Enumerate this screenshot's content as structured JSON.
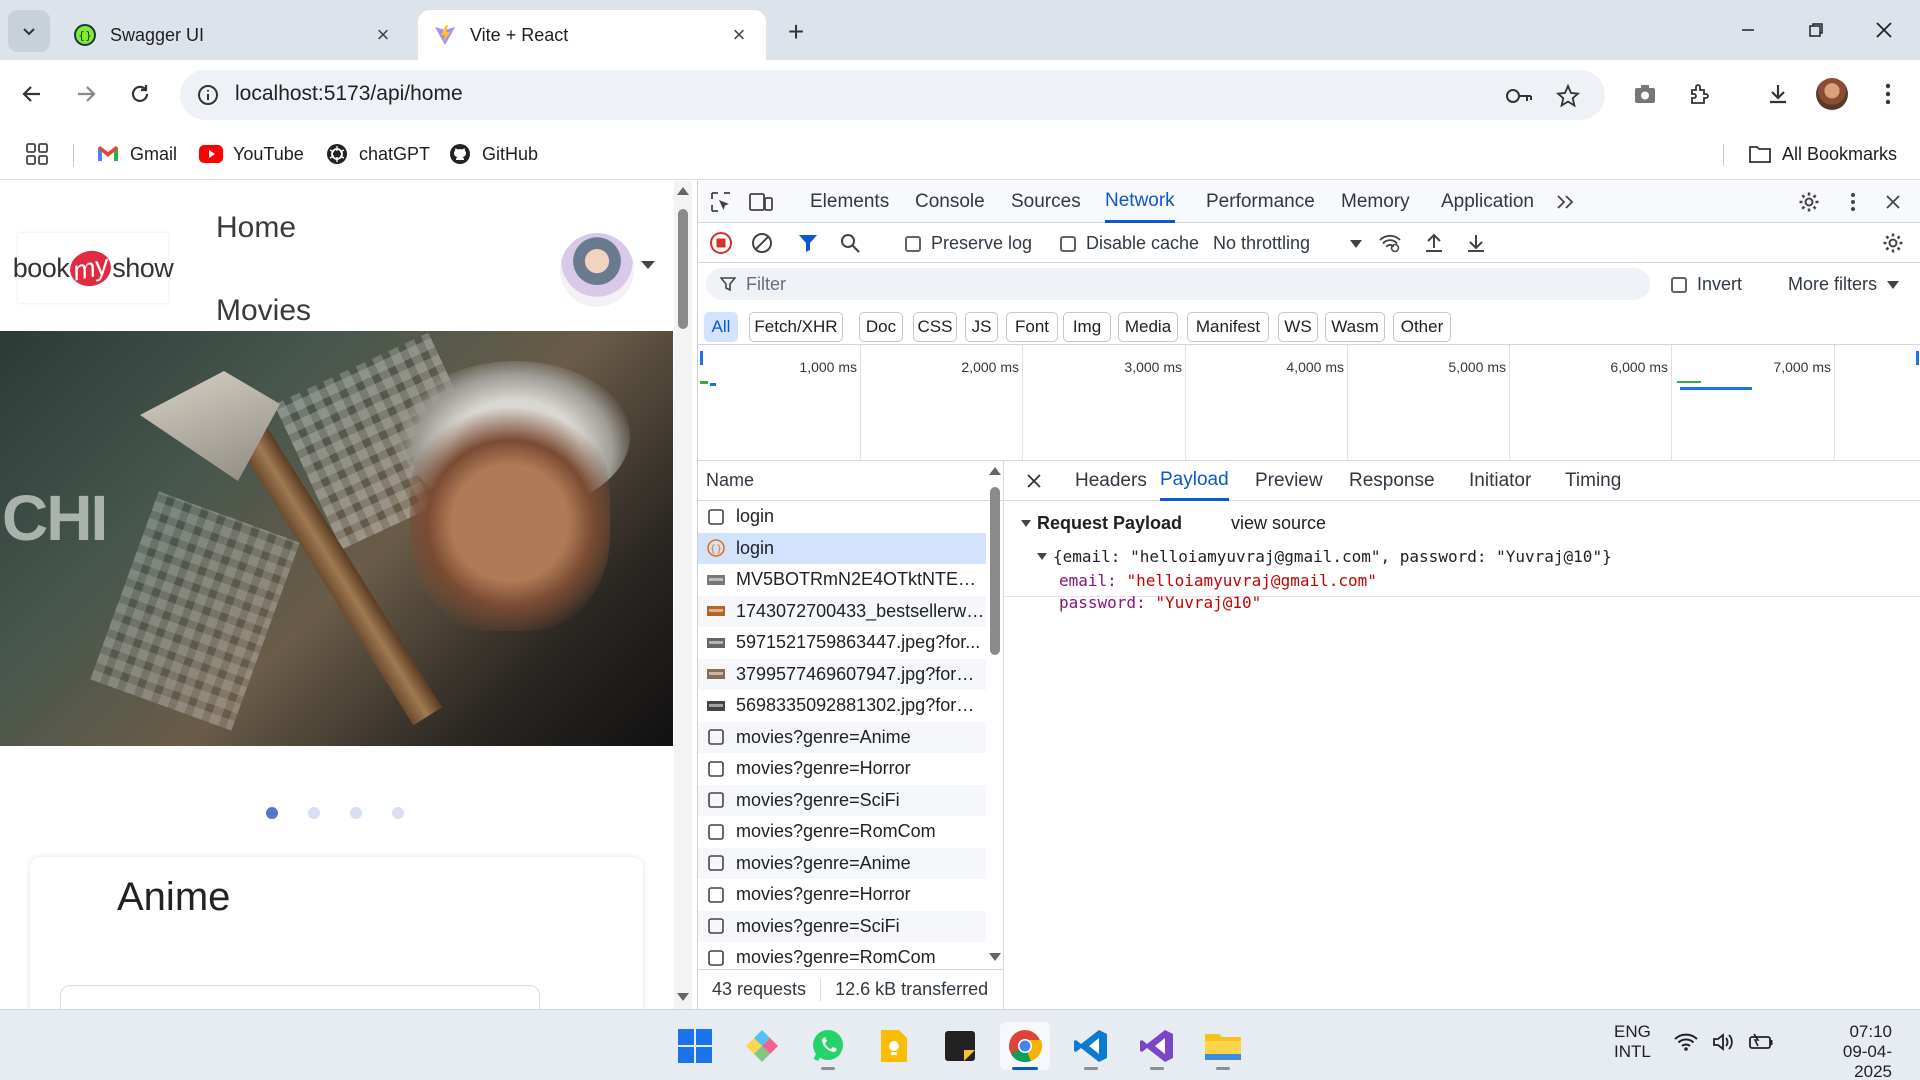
{
  "browser": {
    "tabs": [
      {
        "title": "Swagger UI",
        "active": false
      },
      {
        "title": "Vite + React",
        "active": true
      }
    ],
    "url": "localhost:5173/api/home",
    "bookmarks": [
      {
        "label": "Gmail",
        "icon": "gmail-icon"
      },
      {
        "label": "YouTube",
        "icon": "youtube-icon"
      },
      {
        "label": "chatGPT",
        "icon": "chatgpt-icon"
      },
      {
        "label": "GitHub",
        "icon": "github-icon"
      }
    ],
    "all_bookmarks": "All Bookmarks"
  },
  "site": {
    "logo_left": "book",
    "logo_mid": "my",
    "logo_right": "show",
    "nav": [
      "Home",
      "Movies"
    ],
    "hero_text": "CHI",
    "slides": 4,
    "active_slide": 0,
    "section_title": "Anime"
  },
  "devtools": {
    "tabs": [
      "Elements",
      "Console",
      "Sources",
      "Network",
      "Performance",
      "Memory",
      "Application"
    ],
    "active_tab": "Network",
    "preserve_log": "Preserve log",
    "disable_cache": "Disable cache",
    "throttling": "No throttling",
    "filter_placeholder": "Filter",
    "invert": "Invert",
    "more_filters": "More filters",
    "type_filters": [
      "All",
      "Fetch/XHR",
      "Doc",
      "CSS",
      "JS",
      "Font",
      "Img",
      "Media",
      "Manifest",
      "WS",
      "Wasm",
      "Other"
    ],
    "active_type": "All",
    "timeline_ticks": [
      "1,000 ms",
      "2,000 ms",
      "3,000 ms",
      "4,000 ms",
      "5,000 ms",
      "6,000 ms",
      "7,000 ms"
    ],
    "name_header": "Name",
    "requests": [
      {
        "name": "login",
        "type": "doc"
      },
      {
        "name": "login",
        "type": "fetch",
        "selected": true
      },
      {
        "name": "MV5BOTRmN2E4OTktNTE1O...",
        "type": "img"
      },
      {
        "name": "1743072700433_bestsellerwe...",
        "type": "img"
      },
      {
        "name": "5971521759863447.jpeg?for...",
        "type": "img"
      },
      {
        "name": "3799577469607947.jpg?form...",
        "type": "img"
      },
      {
        "name": "5698335092881302.jpg?form...",
        "type": "img"
      },
      {
        "name": "movies?genre=Anime",
        "type": "doc"
      },
      {
        "name": "movies?genre=Horror",
        "type": "doc"
      },
      {
        "name": "movies?genre=SciFi",
        "type": "doc"
      },
      {
        "name": "movies?genre=RomCom",
        "type": "doc"
      },
      {
        "name": "movies?genre=Anime",
        "type": "doc"
      },
      {
        "name": "movies?genre=Horror",
        "type": "doc"
      },
      {
        "name": "movies?genre=SciFi",
        "type": "doc"
      },
      {
        "name": "movies?genre=RomCom",
        "type": "doc"
      }
    ],
    "footer_requests": "43 requests",
    "footer_transferred": "12.6 kB transferred",
    "detail_tabs": [
      "Headers",
      "Payload",
      "Preview",
      "Response",
      "Initiator",
      "Timing"
    ],
    "active_detail_tab": "Payload",
    "payload_title": "Request Payload",
    "view_source": "view source",
    "payload_summary": "{email: \"helloiamyuvraj@gmail.com\", password: \"Yuvraj@10\"}",
    "payload_fields": [
      {
        "key": "email",
        "value": "\"helloiamyuvraj@gmail.com\""
      },
      {
        "key": "password",
        "value": "\"Yuvraj@10\""
      }
    ]
  },
  "taskbar": {
    "apps": [
      "windows-start",
      "app-launcher",
      "whatsapp",
      "keep-notes",
      "sticky-notes",
      "chrome",
      "vscode",
      "visual-studio",
      "file-explorer"
    ],
    "active_app": "chrome",
    "lang_top": "ENG",
    "lang_bottom": "INTL",
    "time": "07:10",
    "date": "09-04-2025"
  },
  "colors": {
    "accent": "#0b57d0",
    "brand_red": "#e12b40",
    "payload_key": "#881280",
    "payload_value": "#c80000"
  }
}
